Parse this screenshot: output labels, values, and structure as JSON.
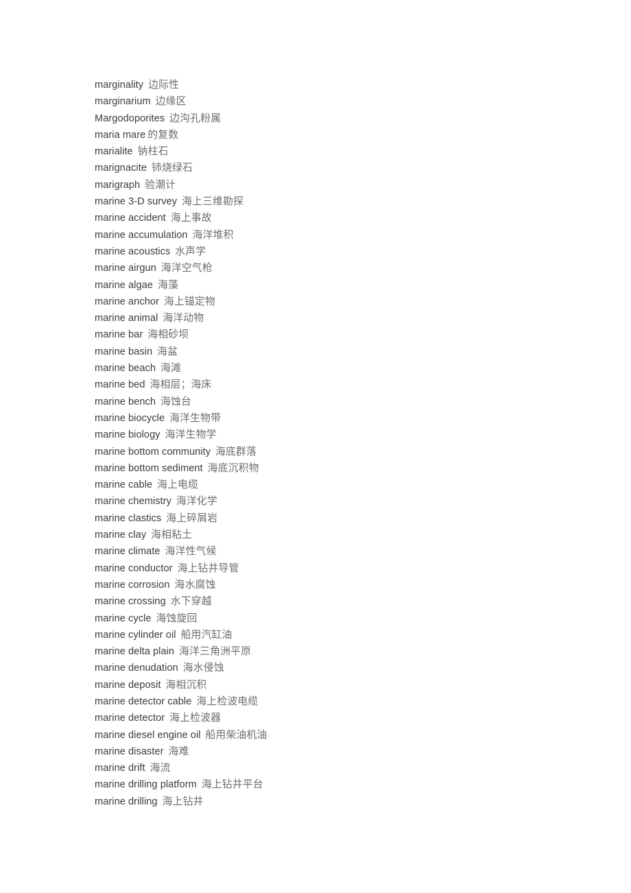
{
  "page": {
    "kind": "bilingual-glossary",
    "background_color": "#ffffff",
    "english_color": "#3b3b3b",
    "chinese_color": "#6d6d6d"
  },
  "entries": [
    {
      "en": "marginality",
      "zh": "边际性",
      "gap": "normal"
    },
    {
      "en": "marginarium",
      "zh": "边缘区",
      "gap": "normal"
    },
    {
      "en": "Margodoporites",
      "zh": "边沟孔粉属",
      "gap": "normal"
    },
    {
      "en": "maria mare",
      "zh": "的复数",
      "gap": "narrow"
    },
    {
      "en": "marialite",
      "zh": "钠柱石",
      "gap": "normal"
    },
    {
      "en": "marignacite",
      "zh": "铈烧绿石",
      "gap": "normal"
    },
    {
      "en": "marigraph",
      "zh": "验潮计",
      "gap": "normal"
    },
    {
      "en": "marine 3-D survey",
      "zh": "海上三维勘探",
      "gap": "normal"
    },
    {
      "en": "marine accident",
      "zh": "海上事故",
      "gap": "normal"
    },
    {
      "en": "marine accumulation",
      "zh": "海洋堆积",
      "gap": "normal"
    },
    {
      "en": "marine acoustics",
      "zh": "水声学",
      "gap": "normal"
    },
    {
      "en": "marine airgun",
      "zh": "海洋空气枪",
      "gap": "normal"
    },
    {
      "en": "marine algae",
      "zh": "海藻",
      "gap": "normal"
    },
    {
      "en": "marine anchor",
      "zh": "海上锚定物",
      "gap": "normal"
    },
    {
      "en": "marine animal",
      "zh": "海洋动物",
      "gap": "normal"
    },
    {
      "en": "marine bar",
      "zh": "海相砂坝",
      "gap": "normal"
    },
    {
      "en": "marine basin",
      "zh": "海盆",
      "gap": "normal"
    },
    {
      "en": "marine beach",
      "zh": "海滩",
      "gap": "normal"
    },
    {
      "en": "marine bed",
      "zh": "海相层；海床",
      "gap": "normal"
    },
    {
      "en": "marine bench",
      "zh": "海蚀台",
      "gap": "normal"
    },
    {
      "en": "marine biocycle",
      "zh": "海洋生物带",
      "gap": "normal"
    },
    {
      "en": "marine biology",
      "zh": "海洋生物学",
      "gap": "normal"
    },
    {
      "en": "marine bottom community",
      "zh": "海底群落",
      "gap": "normal"
    },
    {
      "en": "marine bottom sediment",
      "zh": "海底沉积物",
      "gap": "normal"
    },
    {
      "en": "marine cable",
      "zh": "海上电缆",
      "gap": "normal"
    },
    {
      "en": "marine chemistry",
      "zh": "海洋化学",
      "gap": "normal"
    },
    {
      "en": "marine clastics",
      "zh": "海上碎屑岩",
      "gap": "normal"
    },
    {
      "en": "marine clay",
      "zh": "海相粘土",
      "gap": "normal"
    },
    {
      "en": "marine climate",
      "zh": "海洋性气候",
      "gap": "normal"
    },
    {
      "en": "marine conductor",
      "zh": "海上钻井导管",
      "gap": "normal"
    },
    {
      "en": "marine corrosion",
      "zh": "海水腐蚀",
      "gap": "normal"
    },
    {
      "en": "marine crossing",
      "zh": "水下穿越",
      "gap": "normal"
    },
    {
      "en": "marine cycle",
      "zh": "海蚀旋回",
      "gap": "normal"
    },
    {
      "en": "marine cylinder oil",
      "zh": "船用汽缸油",
      "gap": "normal"
    },
    {
      "en": "marine delta plain",
      "zh": "海洋三角洲平原",
      "gap": "normal"
    },
    {
      "en": "marine denudation",
      "zh": "海水侵蚀",
      "gap": "normal"
    },
    {
      "en": "marine deposit",
      "zh": "海相沉积",
      "gap": "normal"
    },
    {
      "en": "marine detector cable",
      "zh": "海上检波电缆",
      "gap": "normal"
    },
    {
      "en": "marine detector",
      "zh": "海上检波器",
      "gap": "normal"
    },
    {
      "en": "marine diesel engine oil",
      "zh": "船用柴油机油",
      "gap": "normal"
    },
    {
      "en": "marine disaster",
      "zh": "海难",
      "gap": "normal"
    },
    {
      "en": "marine drift",
      "zh": "海流",
      "gap": "normal"
    },
    {
      "en": "marine drilling platform",
      "zh": "海上钻井平台",
      "gap": "normal"
    },
    {
      "en": "marine drilling",
      "zh": "海上钻井",
      "gap": "normal"
    }
  ]
}
